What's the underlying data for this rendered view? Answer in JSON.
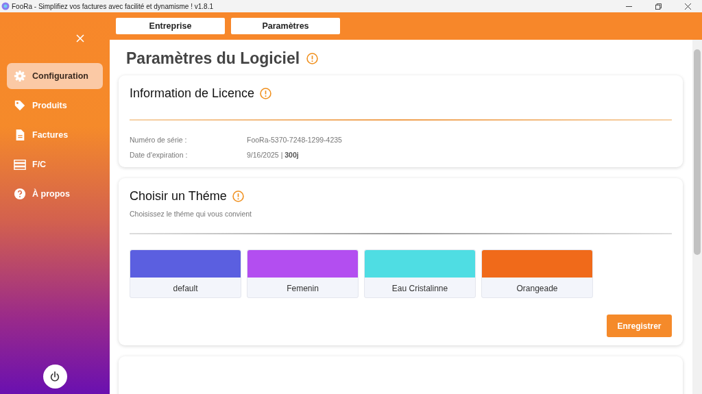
{
  "window": {
    "title": "FooRa - Simplifiez vos factures avec facilité et dynamisme ! v1.8.1"
  },
  "sidebar": {
    "items": [
      {
        "label": "Configuration",
        "kind": "settings",
        "selected": true
      },
      {
        "label": "Produits",
        "kind": "products",
        "selected": false
      },
      {
        "label": "Factures",
        "kind": "invoices",
        "selected": false
      },
      {
        "label": "F/C",
        "kind": "records",
        "selected": false
      },
      {
        "label": "À propos",
        "kind": "about",
        "selected": false
      }
    ]
  },
  "tabs": [
    {
      "label": "Entreprise"
    },
    {
      "label": "Paramètres"
    }
  ],
  "page_title": "Paramètres du Logiciel",
  "license": {
    "title": "Information de Licence",
    "rows": [
      {
        "label": "Numéro de série :",
        "value": "FooRa-5370-7248-1299-4235"
      },
      {
        "label": "Date d'expiration :",
        "value": "9/16/2025 | **300j**"
      }
    ]
  },
  "theme": {
    "title": "Choisir un Théme",
    "subtitle": "Choisissez le théme qui vous convient",
    "themes": [
      {
        "name": "default",
        "color": "#5b5fe0"
      },
      {
        "name": "Femenin",
        "color": "#b34ef0"
      },
      {
        "name": "Eau Cristalinne",
        "color": "#4fdde3"
      },
      {
        "name": "Orangeade",
        "color": "#f06a1a"
      }
    ],
    "save_button": "Enregistrer"
  }
}
